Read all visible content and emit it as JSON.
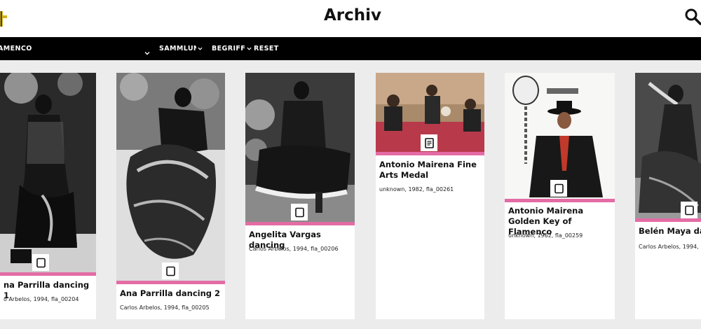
{
  "header": {
    "title": "Archiv",
    "logo_icon": "cross-logo-icon",
    "search_icon": "search-icon"
  },
  "filterbar": {
    "active_filter": "AMENCO",
    "menu": [
      {
        "label": "SAMMLUNG",
        "icon": "chevron-down-icon"
      },
      {
        "label": "BEGRIFF",
        "icon": "chevron-down-icon"
      },
      {
        "label": "RESET"
      }
    ]
  },
  "cards": [
    {
      "title": "na Parrilla dancing 1",
      "meta": "o Arbelos, 1994, fla_00204",
      "type_icon": "image-type-icon"
    },
    {
      "title": "Ana Parrilla dancing 2",
      "meta": "Carlos Arbelos, 1994, fla_00205",
      "type_icon": "image-type-icon"
    },
    {
      "title": "Angelita Vargas dancing",
      "meta": "Carlos Arbelos, 1994, fla_00206",
      "type_icon": "image-type-icon"
    },
    {
      "title": "Antonio Mairena Fine Arts Medal",
      "meta": "unknown, 1982, fla_00261",
      "type_icon": "document-type-icon"
    },
    {
      "title": "Antonio Mairena Golden Key of Flamenco",
      "meta": "unknown, 1962, fla_00259",
      "type_icon": "image-type-icon"
    },
    {
      "title": "Belén Maya dan",
      "meta": "Carlos Arbelos, 1994,",
      "type_icon": "image-type-icon"
    }
  ],
  "colors": {
    "accent": "#e36ca5",
    "bar": "#000000",
    "background": "#ececec"
  }
}
